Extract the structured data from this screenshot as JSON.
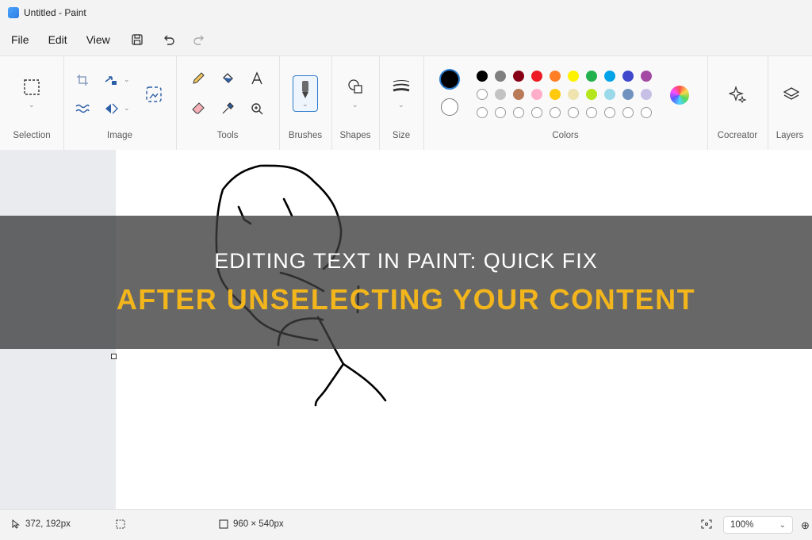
{
  "window": {
    "title": "Untitled - Paint"
  },
  "menu": [
    {
      "label": "File"
    },
    {
      "label": "Edit"
    },
    {
      "label": "View"
    }
  ],
  "ribbon": {
    "groups": {
      "selection": "Selection",
      "image": "Image",
      "tools": "Tools",
      "brushes": "Brushes",
      "shapes": "Shapes",
      "size": "Size",
      "colors": "Colors",
      "cocreator": "Cocreator",
      "layers": "Layers"
    },
    "primary_color": "#000000",
    "secondary_color": "#ffffff",
    "palette_row1": [
      "#000000",
      "#7f7f7f",
      "#880015",
      "#ed1c24",
      "#ff7f27",
      "#fff200",
      "#22b14c",
      "#00a2e8",
      "#3f48cc",
      "#a349a4"
    ],
    "palette_row2": [
      "#ffffff",
      "#c3c3c3",
      "#b97a57",
      "#ffaec9",
      "#ffc90e",
      "#efe4b0",
      "#b5e61d",
      "#99d9ea",
      "#7092be",
      "#c8bfe7"
    ]
  },
  "status": {
    "cursor_pos": "372, 192px",
    "canvas_size": "960 × 540px",
    "zoom": "100%"
  },
  "banner": {
    "line1": "Editing Text in Paint: Quick Fix",
    "line2": "After Unselecting Your Content"
  }
}
